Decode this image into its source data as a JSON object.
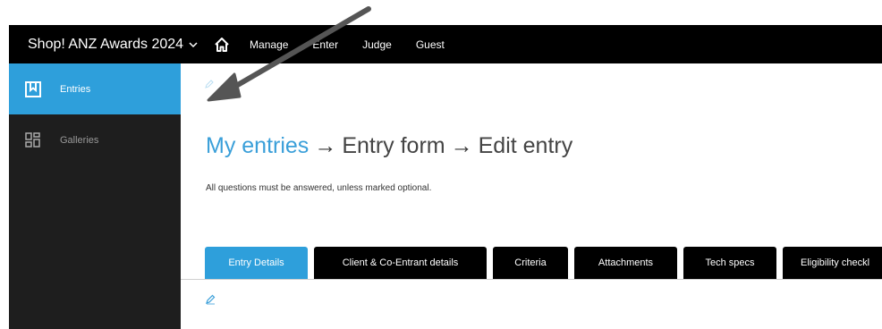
{
  "topbar": {
    "brand": "Shop! ANZ Awards 2024",
    "nav": [
      "Manage",
      "Enter",
      "Judge",
      "Guest"
    ]
  },
  "sidebar": {
    "items": [
      {
        "label": "Entries",
        "icon": "bookmark-icon",
        "active": true
      },
      {
        "label": "Galleries",
        "icon": "grid-icon",
        "active": false
      }
    ]
  },
  "main": {
    "breadcrumb": {
      "link": "My entries",
      "step2": "Entry form",
      "step3": "Edit entry",
      "separator": "→"
    },
    "hint": "All questions must be answered, unless marked optional.",
    "tabs": [
      {
        "label": "Entry Details",
        "active": true
      },
      {
        "label": "Client & Co-Entrant details",
        "active": false
      },
      {
        "label": "Criteria",
        "active": false
      },
      {
        "label": "Attachments",
        "active": false
      },
      {
        "label": "Tech specs",
        "active": false
      },
      {
        "label": "Eligibility checkl",
        "active": false
      }
    ]
  },
  "colors": {
    "accent": "#2e9fdb",
    "topbar": "#000000",
    "sidebar": "#1e1e1e",
    "annotation_arrow": "#555555"
  }
}
